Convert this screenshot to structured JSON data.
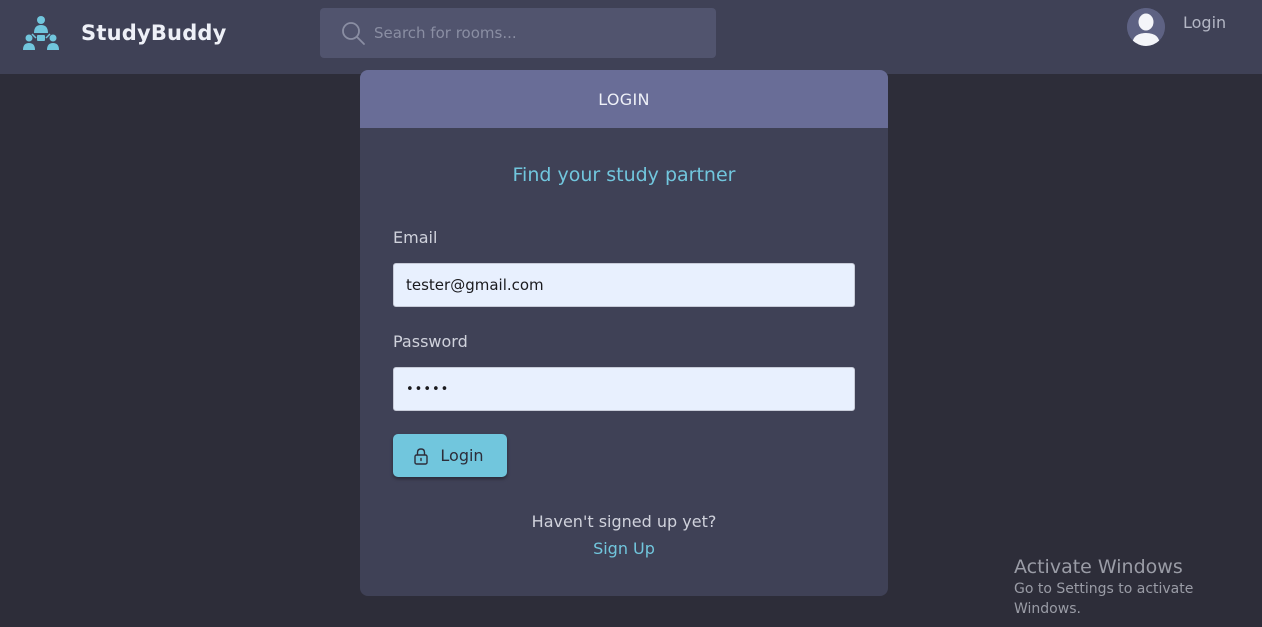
{
  "header": {
    "brand": "StudyBuddy",
    "search_placeholder": "Search for rooms...",
    "user_login": "Login"
  },
  "card": {
    "title": "LOGIN",
    "tagline": "Find your study partner",
    "email_label": "Email",
    "email_value": "tester@gmail.com",
    "password_label": "Password",
    "password_value": "•••••",
    "login_button": "Login",
    "signup_prompt": "Haven't signed up yet?",
    "signup_link": "Sign Up"
  },
  "watermark": {
    "title": "Activate Windows",
    "subtitle": "Go to Settings to activate Windows."
  },
  "colors": {
    "background": "#2d2d39",
    "header": "#3f4156",
    "card_header": "#696d97",
    "accent": "#71c6dd"
  },
  "icons": [
    "logo-icon",
    "search-icon",
    "avatar-icon",
    "lock-icon"
  ]
}
